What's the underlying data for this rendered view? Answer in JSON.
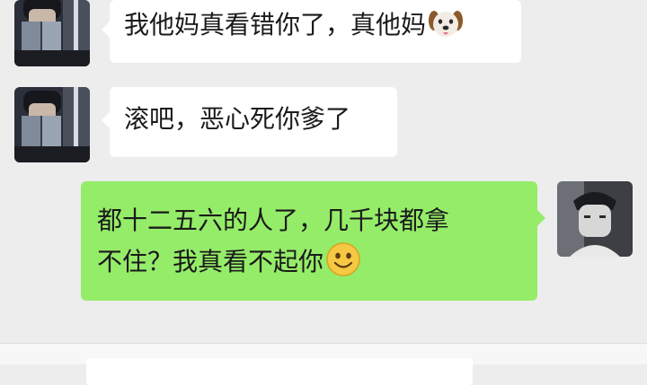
{
  "messages": [
    {
      "side": "left",
      "text": "我他妈真看错你了，真他妈",
      "emoji": "dog-face-emoji"
    },
    {
      "side": "left",
      "text": "滚吧，恶心死你爹了"
    },
    {
      "side": "right",
      "line1": "都十二五六的人了，几千块都拿",
      "line2": "不住？我真看不起你",
      "emoji": "smiling-face-emoji"
    }
  ]
}
